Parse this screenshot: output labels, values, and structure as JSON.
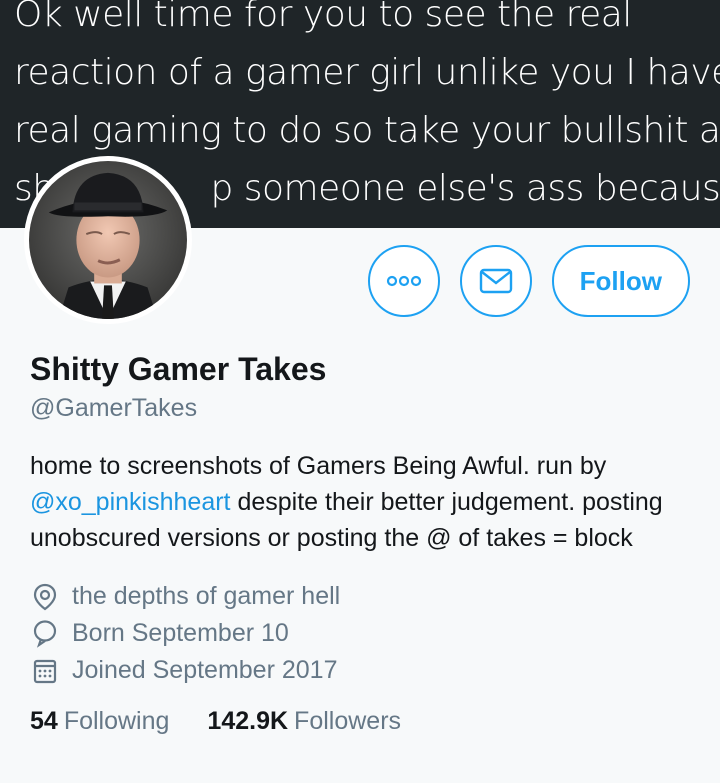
{
  "banner": {
    "lines": [
      "Ok well time for you to see the real",
      "reaction of a gamer girl unlike you I have",
      "real gaming to do so take your bullshit and",
      "sh",
      "p someone else's ass because"
    ]
  },
  "profile": {
    "display_name": "Shitty Gamer Takes",
    "handle": "@GamerTakes",
    "bio": {
      "part1": "home to screenshots of Gamers Being Awful. run by",
      "mention": "@xo_pinkishheart",
      "part2": " despite their better judgement. posting unobscured versions or posting the @ of takes = block"
    },
    "location": "the depths of gamer hell",
    "birthday": "Born September 10",
    "joined": "Joined September 2017",
    "following_count": "54",
    "following_label": "Following",
    "followers_count": "142.9K",
    "followers_label": "Followers"
  },
  "actions": {
    "follow_label": "Follow"
  },
  "icons": {
    "more": "more-icon",
    "message": "envelope-icon",
    "location": "location-pin-icon",
    "birthday": "balloon-icon",
    "joined": "calendar-icon"
  },
  "colors": {
    "accent": "#1da1f2",
    "link": "#1b95e0",
    "secondary_text": "#657786"
  }
}
